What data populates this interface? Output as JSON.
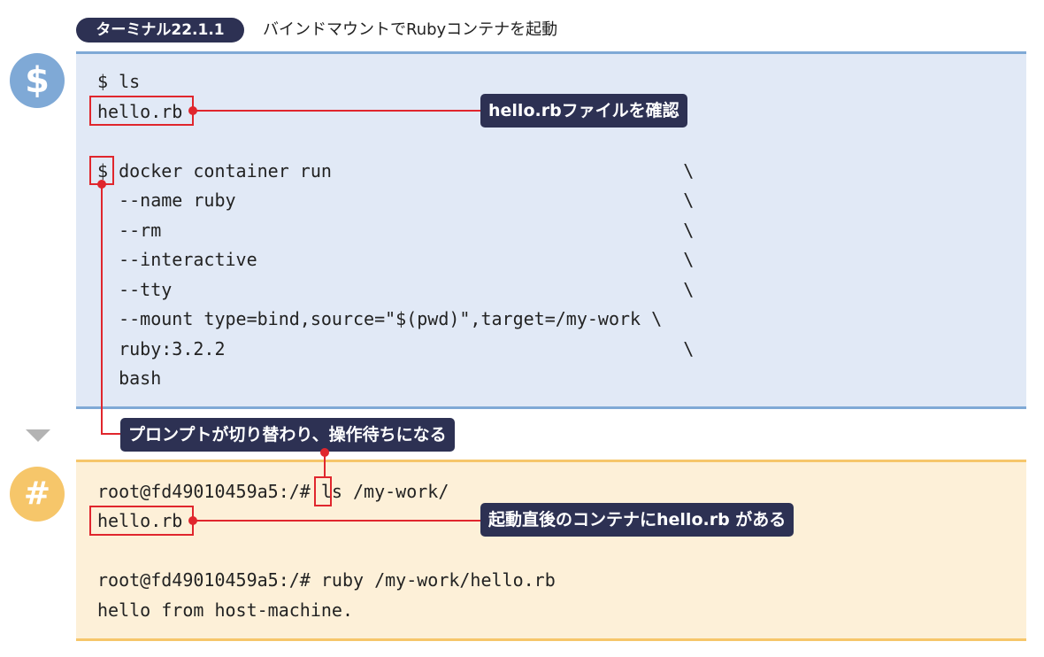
{
  "header": {
    "badge": "ターミナル22.1.1",
    "title": "バインドマウントでRubyコンテナを起動"
  },
  "icons": {
    "host_symbol": "$",
    "container_symbol": "#"
  },
  "host_terminal": {
    "lines": [
      "$ ls",
      "hello.rb",
      "",
      "$ docker container run                                 \\",
      "  --name ruby                                          \\",
      "  --rm                                                 \\",
      "  --interactive                                        \\",
      "  --tty                                                \\",
      "  --mount type=bind,source=\"$(pwd)\",target=/my-work \\",
      "  ruby:3.2.2                                           \\",
      "  bash"
    ]
  },
  "container_terminal": {
    "lines": [
      "root@fd49010459a5:/# ls /my-work/",
      "hello.rb",
      "",
      "root@fd49010459a5:/# ruby /my-work/hello.rb",
      "hello from host-machine."
    ]
  },
  "callouts": {
    "confirm_file": "hello.rbファイルを確認",
    "prompt_change": "プロンプトが切り替わり、操作待ちになる",
    "file_exists": "起動直後のコンテナにhello.rb がある"
  },
  "colors": {
    "accent_red": "#e0262d",
    "callout_bg": "#2d3153",
    "host_bg": "#e1e9f6",
    "host_border": "#7fa9d6",
    "container_bg": "#fdf0d8",
    "container_border": "#f6c66a"
  }
}
